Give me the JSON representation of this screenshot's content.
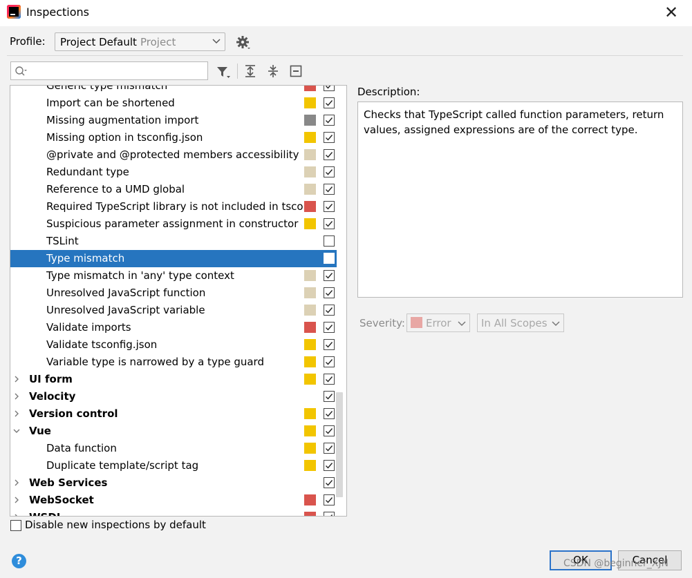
{
  "window": {
    "title": "Inspections",
    "close_symbol": "✕"
  },
  "profile": {
    "label": "Profile:",
    "value": "Project Default",
    "scope": "Project"
  },
  "search": {
    "placeholder": ""
  },
  "colors": {
    "error": "#d9544d",
    "warning": "#f2c500",
    "weak_warning": "#dcd1b5",
    "server_problem": "#888888",
    "selection": "#2675bf"
  },
  "tree": {
    "rows": [
      {
        "label": "Generic type mismatch",
        "kind": "child",
        "severity": "error",
        "checked": true
      },
      {
        "label": "Import can be shortened",
        "kind": "child",
        "severity": "warning",
        "checked": true
      },
      {
        "label": "Missing augmentation import",
        "kind": "child",
        "severity": "server_problem",
        "checked": true
      },
      {
        "label": "Missing option in tsconfig.json",
        "kind": "child",
        "severity": "warning",
        "checked": true
      },
      {
        "label": "@private and @protected members accessibility",
        "kind": "child",
        "severity": "weak_warning",
        "checked": true
      },
      {
        "label": "Redundant type",
        "kind": "child",
        "severity": "weak_warning",
        "checked": true
      },
      {
        "label": "Reference to a UMD global",
        "kind": "child",
        "severity": "weak_warning",
        "checked": true
      },
      {
        "label": "Required TypeScript library is not included in tscor",
        "kind": "child",
        "severity": "error",
        "checked": true
      },
      {
        "label": "Suspicious parameter assignment in constructor",
        "kind": "child",
        "severity": "warning",
        "checked": true
      },
      {
        "label": "TSLint",
        "kind": "child",
        "severity": "",
        "checked": false
      },
      {
        "label": "Type mismatch",
        "kind": "child",
        "severity": "",
        "checked": false,
        "selected": true
      },
      {
        "label": "Type mismatch in 'any' type context",
        "kind": "child",
        "severity": "weak_warning",
        "checked": true
      },
      {
        "label": "Unresolved JavaScript function",
        "kind": "child",
        "severity": "weak_warning",
        "checked": true
      },
      {
        "label": "Unresolved JavaScript variable",
        "kind": "child",
        "severity": "weak_warning",
        "checked": true
      },
      {
        "label": "Validate imports",
        "kind": "child",
        "severity": "error",
        "checked": true
      },
      {
        "label": "Validate tsconfig.json",
        "kind": "child",
        "severity": "warning",
        "checked": true
      },
      {
        "label": "Variable type is narrowed by a type guard",
        "kind": "child",
        "severity": "warning",
        "checked": true
      },
      {
        "label": "UI form",
        "kind": "group",
        "expanded": false,
        "severity": "warning",
        "checked": true
      },
      {
        "label": "Velocity",
        "kind": "group",
        "expanded": false,
        "severity": "",
        "checked": true
      },
      {
        "label": "Version control",
        "kind": "group",
        "expanded": false,
        "severity": "warning",
        "checked": true
      },
      {
        "label": "Vue",
        "kind": "group",
        "expanded": true,
        "severity": "warning",
        "checked": true
      },
      {
        "label": "Data function",
        "kind": "child",
        "severity": "warning",
        "checked": true
      },
      {
        "label": "Duplicate template/script tag",
        "kind": "child",
        "severity": "warning",
        "checked": true
      },
      {
        "label": "Web Services",
        "kind": "group",
        "expanded": false,
        "severity": "",
        "checked": true
      },
      {
        "label": "WebSocket",
        "kind": "group",
        "expanded": false,
        "severity": "error",
        "checked": true
      },
      {
        "label": "WSDL",
        "kind": "group",
        "expanded": false,
        "severity": "error",
        "checked": true
      }
    ]
  },
  "disable_new": {
    "label": "Disable new inspections by default",
    "checked": false
  },
  "description": {
    "label": "Description:",
    "text": "Checks that TypeScript called function parameters, return values, assigned expressions are of the correct type."
  },
  "severity": {
    "label": "Severity:",
    "value": "Error",
    "scope": "In All Scopes"
  },
  "buttons": {
    "help": "?",
    "ok": "OK",
    "cancel": "Cancel"
  },
  "watermark": "CSDN @beginner_XJN"
}
